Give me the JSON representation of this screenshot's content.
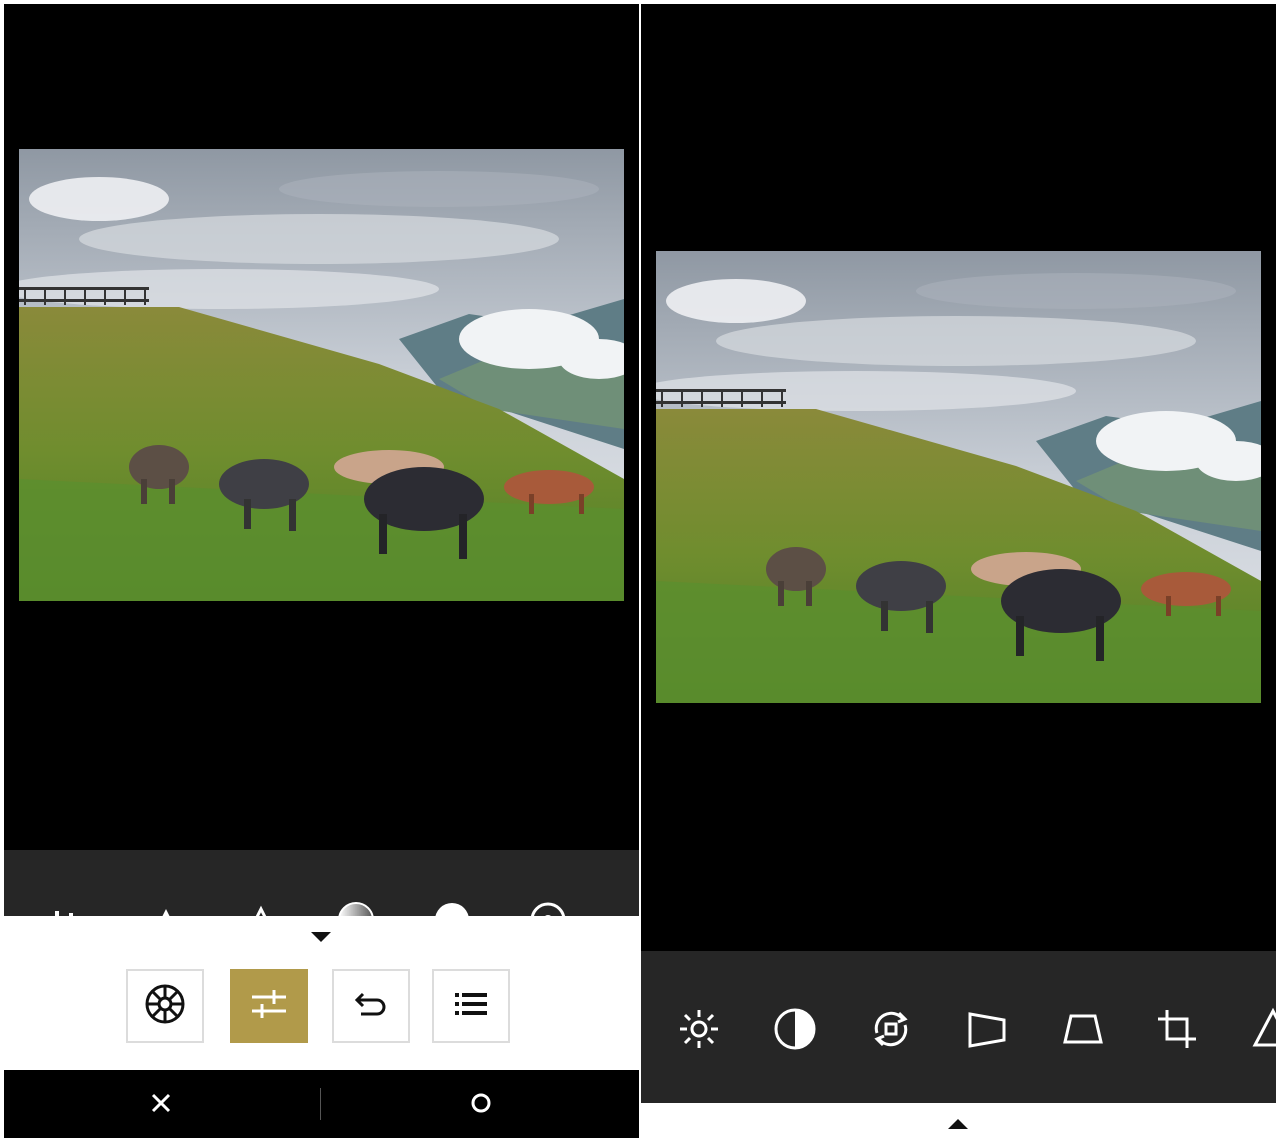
{
  "left_screen": {
    "photo": {
      "description_icon": "landscape-photo-icon"
    },
    "tool_strip": {
      "icons": [
        "histogram-icon",
        "sharpen-icon",
        "highlights-icon",
        "gradient-icon",
        "vignette-icon",
        "color-temp-icon"
      ]
    },
    "mode_bar": {
      "buttons": [
        {
          "icon": "aperture-icon",
          "active": false
        },
        {
          "icon": "sliders-icon",
          "active": true
        },
        {
          "icon": "undo-icon",
          "active": false
        },
        {
          "icon": "list-icon",
          "active": false
        }
      ],
      "accent_color": "#b19a4a"
    },
    "action_bar": {
      "cancel_icon": "close-icon",
      "confirm_icon": "circle-icon"
    }
  },
  "right_screen": {
    "tool_bar": {
      "icons": [
        "brightness-icon",
        "contrast-icon",
        "rotate-icon",
        "perspective-icon",
        "trapezoid-icon",
        "crop-icon",
        "triangle-icon"
      ]
    }
  },
  "colors": {
    "background": "#000000",
    "toolbar": "#262626",
    "accent": "#b19a4a"
  }
}
